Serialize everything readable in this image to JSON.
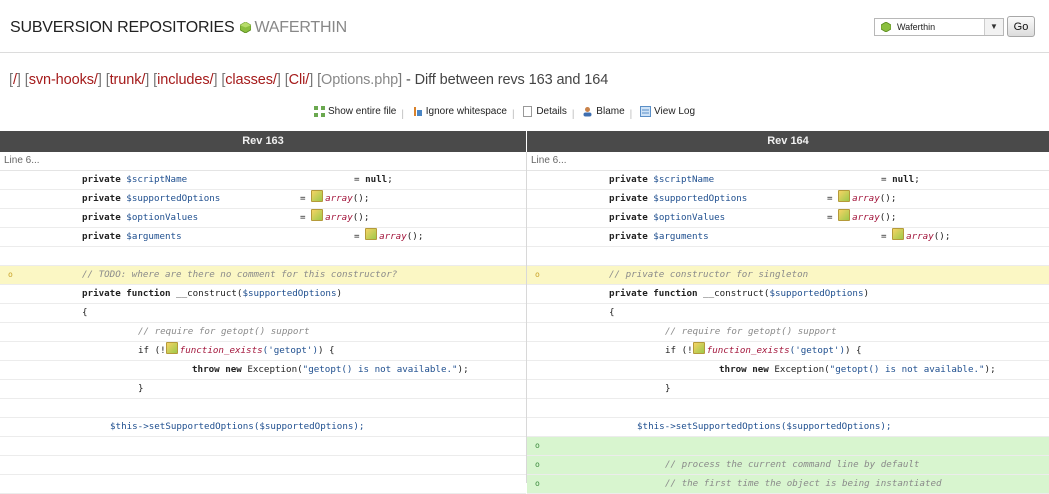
{
  "header": {
    "title": "SUBVERSION REPOSITORIES",
    "repo_name": "WAFERTHIN",
    "repo_select_value": "Waferthin",
    "go_label": "Go"
  },
  "breadcrumb": {
    "root": "/",
    "svn_hooks": "svn-hooks/",
    "trunk": "trunk/",
    "includes": "includes/",
    "classes": "classes/",
    "cli": "Cli/",
    "file": "Options.php",
    "suffix": " - Diff between revs 163 and 164"
  },
  "toolbar": {
    "show_entire_file": "Show entire file",
    "ignore_whitespace": "Ignore whitespace",
    "details": "Details",
    "blame": "Blame",
    "view_log": "View Log"
  },
  "diff": {
    "left_header": "Rev 163",
    "right_header": "Rev 164",
    "left_line_label": "Line 6...",
    "right_line_label": "Line 6...",
    "left": {
      "l1_kw": "private",
      "l1_var": "$scriptName",
      "l1_eq": "= ",
      "l1_val": "null",
      "l1_end": ";",
      "l2_kw": "private",
      "l2_var": "$supportedOptions",
      "l2_eq": "= ",
      "l2_fn": "array",
      "l2_end": "();",
      "l3_kw": "private",
      "l3_var": "$optionValues",
      "l3_eq": "= ",
      "l3_fn": "array",
      "l3_end": "();",
      "l4_kw": "private",
      "l4_var": "$arguments",
      "l4_eq": "= ",
      "l4_fn": "array",
      "l4_end": "();",
      "c1": "// TODO: where are there no comment for this constructor?",
      "ctor_kw": "private function",
      "ctor_name": " __construct(",
      "ctor_var": "$supportedOptions",
      "ctor_end": ")",
      "brace_open": "{",
      "c2": "// require for getopt() support",
      "if_start": "if (!",
      "if_fn": "function_exists",
      "if_str": "('getopt')",
      "if_end": ") {",
      "throw_kw": "throw new",
      "throw_rest": " Exception(",
      "throw_str": "\"getopt() is not available.\"",
      "throw_end": ");",
      "brace_close": "}",
      "set_call": "$this->setSupportedOptions($supportedOptions);"
    },
    "right": {
      "l1_kw": "private",
      "l1_var": "$scriptName",
      "l1_eq": "= ",
      "l1_val": "null",
      "l1_end": ";",
      "l2_kw": "private",
      "l2_var": "$supportedOptions",
      "l2_eq": "= ",
      "l2_fn": "array",
      "l2_end": "();",
      "l3_kw": "private",
      "l3_var": "$optionValues",
      "l3_eq": "= ",
      "l3_fn": "array",
      "l3_end": "();",
      "l4_kw": "private",
      "l4_var": "$arguments",
      "l4_eq": "= ",
      "l4_fn": "array",
      "l4_end": "();",
      "c1": "// private constructor for singleton",
      "ctor_kw": "private function",
      "ctor_name": " __construct(",
      "ctor_var": "$supportedOptions",
      "ctor_end": ")",
      "brace_open": "{",
      "c2": "// require for getopt() support",
      "if_start": "if (!",
      "if_fn": "function_exists",
      "if_str": "('getopt')",
      "if_end": ") {",
      "throw_kw": "throw new",
      "throw_rest": " Exception(",
      "throw_str": "\"getopt() is not available.\"",
      "throw_end": ");",
      "brace_close": "}",
      "set_call": "$this->setSupportedOptions($supportedOptions);",
      "c3": "// process the current command line by default",
      "c4": "// the first time the object is being instantiated"
    },
    "marks": {
      "changed": "o",
      "added": "o"
    }
  },
  "colors": {
    "link": "#a51b1b",
    "header_bar": "#4a4a4a",
    "changed_bg": "#fbf7c4",
    "added_bg": "#d8f5cf"
  }
}
